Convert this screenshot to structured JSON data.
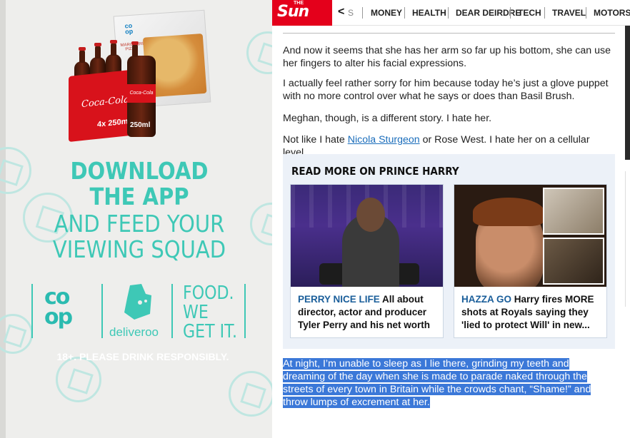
{
  "ad": {
    "headline_1": "DOWNLOAD",
    "headline_2": "THE APP",
    "headline_3": "AND FEED YOUR",
    "headline_4": "VIEWING SQUAD",
    "coop_logo": "co op",
    "deliveroo_label": "deliveroo",
    "tagline": "FOOD.\nWE\nGET IT.",
    "disclaimer": "18+. PLEASE DRINK RESPONSIBLY.",
    "product_crate_brand": "Coca-Cola",
    "product_crate_size": "4x 250ml",
    "product_bottle_size": "250ml",
    "product_bottle_brand": "Coca-Cola",
    "pizza_brand": "co op",
    "pizza_label": "MARGHERITA PIZZA",
    "accent_color": "#3ec8b6"
  },
  "nav": {
    "logo_text": "Sun",
    "logo_small": "THE",
    "back_chevron": "<",
    "items": [
      "S",
      "MONEY",
      "HEALTH",
      "DEAR DEIRDRE",
      "TECH",
      "TRAVEL",
      "MOTORS"
    ],
    "brand_color": "#e4001b"
  },
  "article": {
    "paragraphs": [
      "And now it seems that she has her arm so far up his bottom, she can use her fingers to alter his facial expressions.",
      "I actually feel rather sorry for him because today he’s just a glove puppet with no more control over what he says or does than Basil Brush.",
      "Meghan, though, is a different story. I hate her."
    ],
    "p4_before": "Not like I hate ",
    "p4_link": "Nicola Sturgeon",
    "p4_after": " or Rose West. I hate her on a cellular level.",
    "selected_text": "At night, I’m unable to sleep as I lie there, grinding my teeth and dreaming of the day when she is made to parade naked through the streets of every town in Britain while the crowds chant, “Shame!” and throw lumps of excrement at her."
  },
  "read_more": {
    "title": "READ MORE ON PRINCE HARRY",
    "cards": [
      {
        "kicker": "PERRY NICE LIFE",
        "text": " All about director, actor and producer Tyler Perry and his net worth"
      },
      {
        "kicker": "HAZZA GO",
        "text": " Harry fires MORE shots at Royals saying they 'lied to protect Will' in new..."
      }
    ]
  }
}
